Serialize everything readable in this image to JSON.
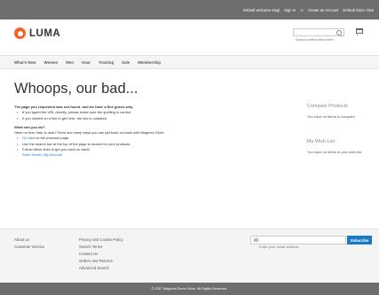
{
  "header": {
    "links": [
      "Default welcome msg!",
      "Sign In",
      "or",
      "Create an Account",
      "Default Store View"
    ],
    "logo_text": "LUMA",
    "search_placeholder": "Search entire store here...",
    "brand_color": "#f26322"
  },
  "nav": {
    "items": [
      "What's New",
      "Women",
      "Men",
      "Gear",
      "Training",
      "Sale",
      "Membership"
    ]
  },
  "main": {
    "title": "Whoops, our bad...",
    "intro": "The page you requested was not found, and we have a fine guess why.",
    "reasons": [
      "If you typed the URL directly, please make sure the spelling is correct.",
      "If you clicked on a link to get here, the link is outdated."
    ],
    "what_heading": "What can you do?",
    "what_intro": "Have no fear, help is near! There are many ways you can get back on track with Magento Store.",
    "action_go_back_link": "Go back",
    "action_go_back_rest": " to the previous page.",
    "action_search": "Use the search bar at the top of the page to search for your products.",
    "action_follow": "Follow these links to get you back on track!",
    "store_home": "Store Home",
    "link_sep": "|",
    "my_account": "My Account"
  },
  "sidebar": {
    "compare_title": "Compare Products",
    "compare_text": "You have no items to compare.",
    "wishlist_title": "My Wish List",
    "wishlist_text": "You have no items in your wish list."
  },
  "footer": {
    "col1": [
      "About us",
      "Customer Service"
    ],
    "col2": [
      "Privacy and Cookie Policy",
      "Search Terms",
      "Contact Us",
      "Orders and Returns",
      "Advanced Search"
    ],
    "newsletter_placeholder": "Enter your email address",
    "subscribe_label": "Subscribe",
    "subscribe_color": "#1979c3",
    "copyright": "© 2017 Magento Demo Store. All Rights Reserved."
  }
}
